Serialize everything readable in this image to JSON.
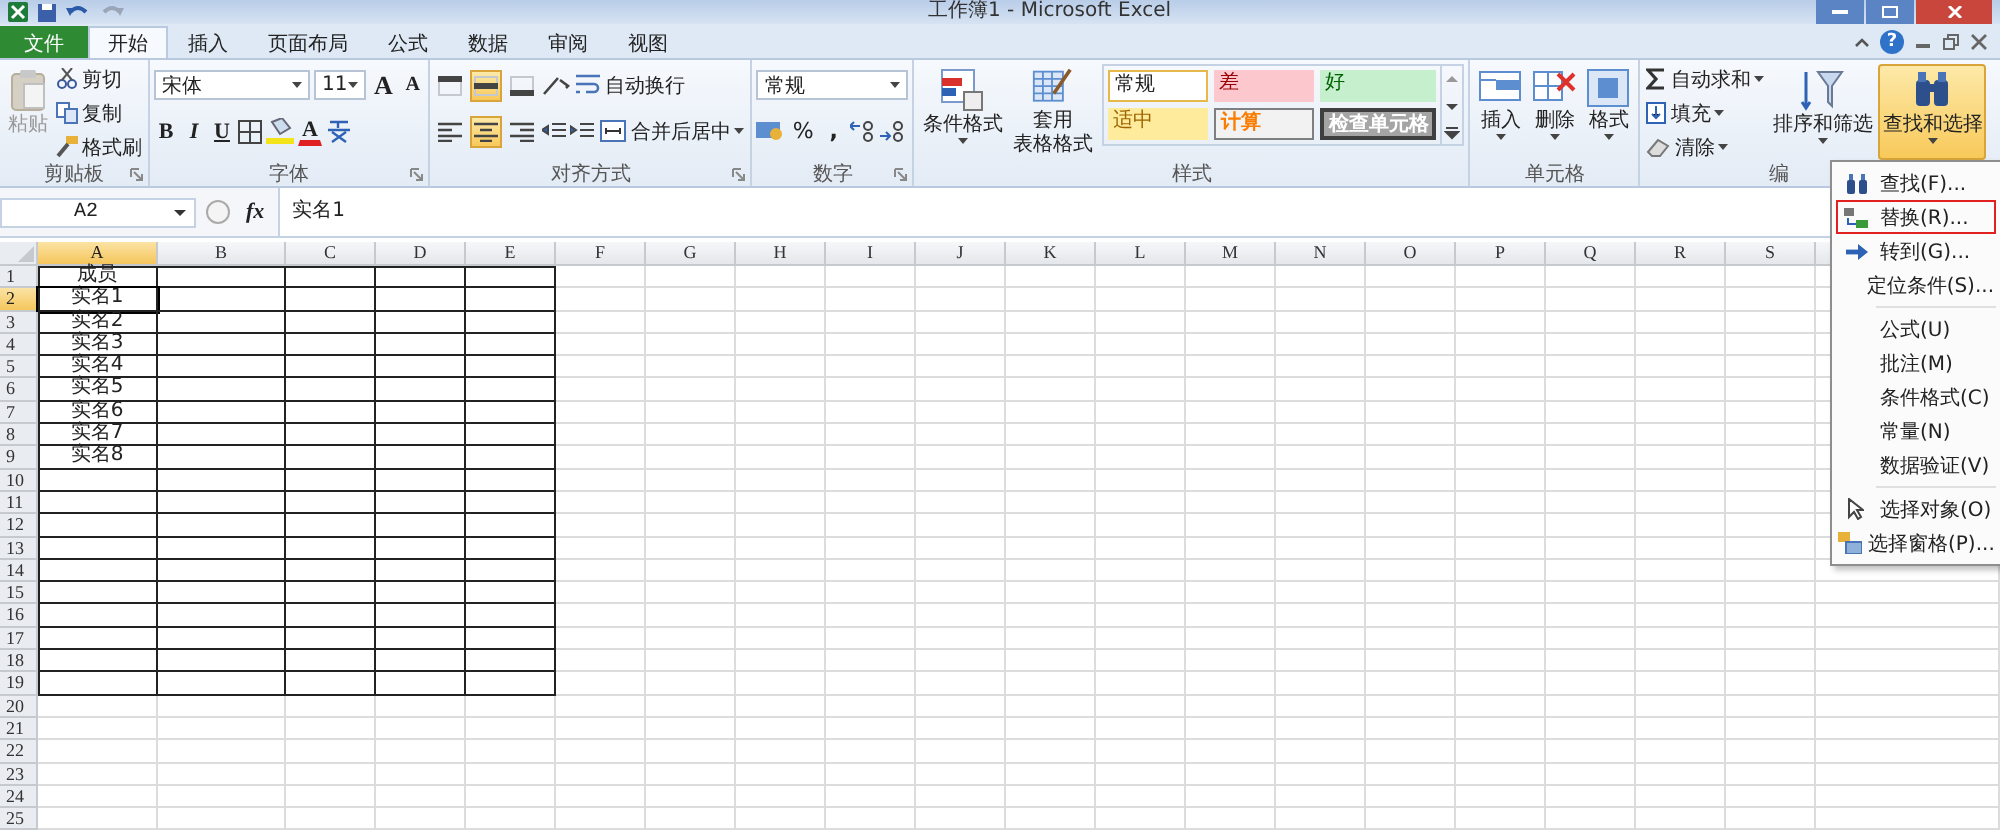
{
  "window": {
    "title": "工作簿1 - Microsoft Excel"
  },
  "tabs": [
    {
      "label": "文件",
      "kind": "file",
      "selected": false
    },
    {
      "label": "开始",
      "kind": "tab",
      "selected": true
    },
    {
      "label": "插入",
      "kind": "tab",
      "selected": false
    },
    {
      "label": "页面布局",
      "kind": "tab",
      "selected": false
    },
    {
      "label": "公式",
      "kind": "tab",
      "selected": false
    },
    {
      "label": "数据",
      "kind": "tab",
      "selected": false
    },
    {
      "label": "审阅",
      "kind": "tab",
      "selected": false
    },
    {
      "label": "视图",
      "kind": "tab",
      "selected": false
    }
  ],
  "help": "?",
  "ribbon": [
    {
      "kind": "clipboard",
      "label": "剪贴板",
      "paste": "粘贴",
      "paste_disabled": true,
      "items": [
        "剪切",
        "复制",
        "格式刷"
      ]
    },
    {
      "kind": "font",
      "label": "字体",
      "font": "宋体",
      "size": "11",
      "grow": "A",
      "shrink": "A",
      "bold": "B",
      "italic": "I",
      "underline": "U",
      "font_color": "A"
    },
    {
      "kind": "alignment",
      "label": "对齐方式",
      "wrap": "自动换行",
      "merge": "合并后居中",
      "vertical": [
        {
          "kind": "top",
          "selected": false
        },
        {
          "kind": "middle",
          "selected": true
        },
        {
          "kind": "bottom",
          "selected": false
        }
      ],
      "horizontal": [
        {
          "kind": "left",
          "selected": false
        },
        {
          "kind": "center",
          "selected": true
        },
        {
          "kind": "right",
          "selected": false
        }
      ]
    },
    {
      "kind": "number",
      "label": "数字",
      "format": "常规",
      "percent": "%",
      "comma": ","
    },
    {
      "kind": "styles",
      "label": "样式",
      "conditional": "条件格式",
      "table_format": [
        "套用",
        "表格格式"
      ],
      "gallery": [
        {
          "label": "常规",
          "kind": "normal"
        },
        {
          "label": "差",
          "kind": "bad"
        },
        {
          "label": "好",
          "kind": "good"
        },
        {
          "label": "适中",
          "kind": "neutral"
        },
        {
          "label": "计算",
          "kind": "calc"
        },
        {
          "label": "检查单元格",
          "kind": "check"
        }
      ]
    },
    {
      "kind": "cells",
      "label": "单元格",
      "buttons": [
        "插入",
        "删除",
        "格式"
      ]
    },
    {
      "kind": "editing",
      "label": "编",
      "small": [
        "自动求和",
        "填充",
        "清除"
      ],
      "sort": "排序和筛选",
      "find": "查找和选择",
      "find_open": true
    }
  ],
  "formula_bar": {
    "name_box": "A2",
    "fx": "fx",
    "value": "实名1"
  },
  "sheet": {
    "columns": [
      {
        "label": "A",
        "selected": true,
        "bordered": true
      },
      {
        "label": "B",
        "selected": false,
        "bordered": true
      },
      {
        "label": "C",
        "selected": false,
        "bordered": true
      },
      {
        "label": "D",
        "selected": false,
        "bordered": true
      },
      {
        "label": "E",
        "selected": false,
        "bordered": true
      },
      {
        "label": "F",
        "selected": false,
        "bordered": false
      },
      {
        "label": "G",
        "selected": false,
        "bordered": false
      },
      {
        "label": "H",
        "selected": false,
        "bordered": false
      },
      {
        "label": "I",
        "selected": false,
        "bordered": false
      },
      {
        "label": "J",
        "selected": false,
        "bordered": false
      },
      {
        "label": "K",
        "selected": false,
        "bordered": false
      },
      {
        "label": "L",
        "selected": false,
        "bordered": false
      },
      {
        "label": "M",
        "selected": false,
        "bordered": false
      },
      {
        "label": "N",
        "selected": false,
        "bordered": false
      },
      {
        "label": "O",
        "selected": false,
        "bordered": false
      },
      {
        "label": "P",
        "selected": false,
        "bordered": false
      },
      {
        "label": "Q",
        "selected": false,
        "bordered": false
      },
      {
        "label": "R",
        "selected": false,
        "bordered": false
      },
      {
        "label": "S",
        "selected": false,
        "bordered": false
      }
    ],
    "rows": [
      {
        "number": "1",
        "selected": false,
        "bordered": true,
        "cells": [
          "成员"
        ]
      },
      {
        "number": "2",
        "selected": true,
        "bordered": true,
        "cells": [
          "实名1"
        ]
      },
      {
        "number": "3",
        "selected": false,
        "bordered": true,
        "cells": [
          "实名2"
        ]
      },
      {
        "number": "4",
        "selected": false,
        "bordered": true,
        "cells": [
          "实名3"
        ]
      },
      {
        "number": "5",
        "selected": false,
        "bordered": true,
        "cells": [
          "实名4"
        ]
      },
      {
        "number": "6",
        "selected": false,
        "bordered": true,
        "cells": [
          "实名5"
        ]
      },
      {
        "number": "7",
        "selected": false,
        "bordered": true,
        "cells": [
          "实名6"
        ]
      },
      {
        "number": "8",
        "selected": false,
        "bordered": true,
        "cells": [
          "实名7"
        ]
      },
      {
        "number": "9",
        "selected": false,
        "bordered": true,
        "cells": [
          "实名8"
        ]
      },
      {
        "number": "10",
        "selected": false,
        "bordered": true
      },
      {
        "number": "11",
        "selected": false,
        "bordered": true
      },
      {
        "number": "12",
        "selected": false,
        "bordered": true
      },
      {
        "number": "13",
        "selected": false,
        "bordered": true
      },
      {
        "number": "14",
        "selected": false,
        "bordered": true
      },
      {
        "number": "15",
        "selected": false,
        "bordered": true
      },
      {
        "number": "16",
        "selected": false,
        "bordered": true
      },
      {
        "number": "17",
        "selected": false,
        "bordered": true
      },
      {
        "number": "18",
        "selected": false,
        "bordered": true
      },
      {
        "number": "19",
        "selected": false,
        "bordered": true
      },
      {
        "number": "20",
        "selected": false,
        "bordered": false
      },
      {
        "number": "21",
        "selected": false,
        "bordered": false
      },
      {
        "number": "22",
        "selected": false,
        "bordered": false
      },
      {
        "number": "23",
        "selected": false,
        "bordered": false
      },
      {
        "number": "24",
        "selected": false,
        "bordered": false
      },
      {
        "number": "25",
        "selected": false,
        "bordered": false
      }
    ]
  },
  "menu": [
    [
      {
        "label": "查找(F)...",
        "kind": "find",
        "highlighted": false
      },
      {
        "label": "替换(R)...",
        "kind": "replace",
        "highlighted": true
      },
      {
        "label": "转到(G)...",
        "kind": "goto",
        "highlighted": false
      },
      {
        "label": "定位条件(S)...",
        "kind": "plain",
        "highlighted": false
      }
    ],
    [
      {
        "label": "公式(U)",
        "kind": "plain",
        "highlighted": false
      },
      {
        "label": "批注(M)",
        "kind": "plain",
        "highlighted": false
      },
      {
        "label": "条件格式(C)",
        "kind": "plain",
        "highlighted": false
      },
      {
        "label": "常量(N)",
        "kind": "plain",
        "highlighted": false
      },
      {
        "label": "数据验证(V)",
        "kind": "plain",
        "highlighted": false
      }
    ],
    [
      {
        "label": "选择对象(O)",
        "kind": "select",
        "highlighted": false
      },
      {
        "label": "选择窗格(P)...",
        "kind": "pane",
        "highlighted": false
      }
    ]
  ]
}
